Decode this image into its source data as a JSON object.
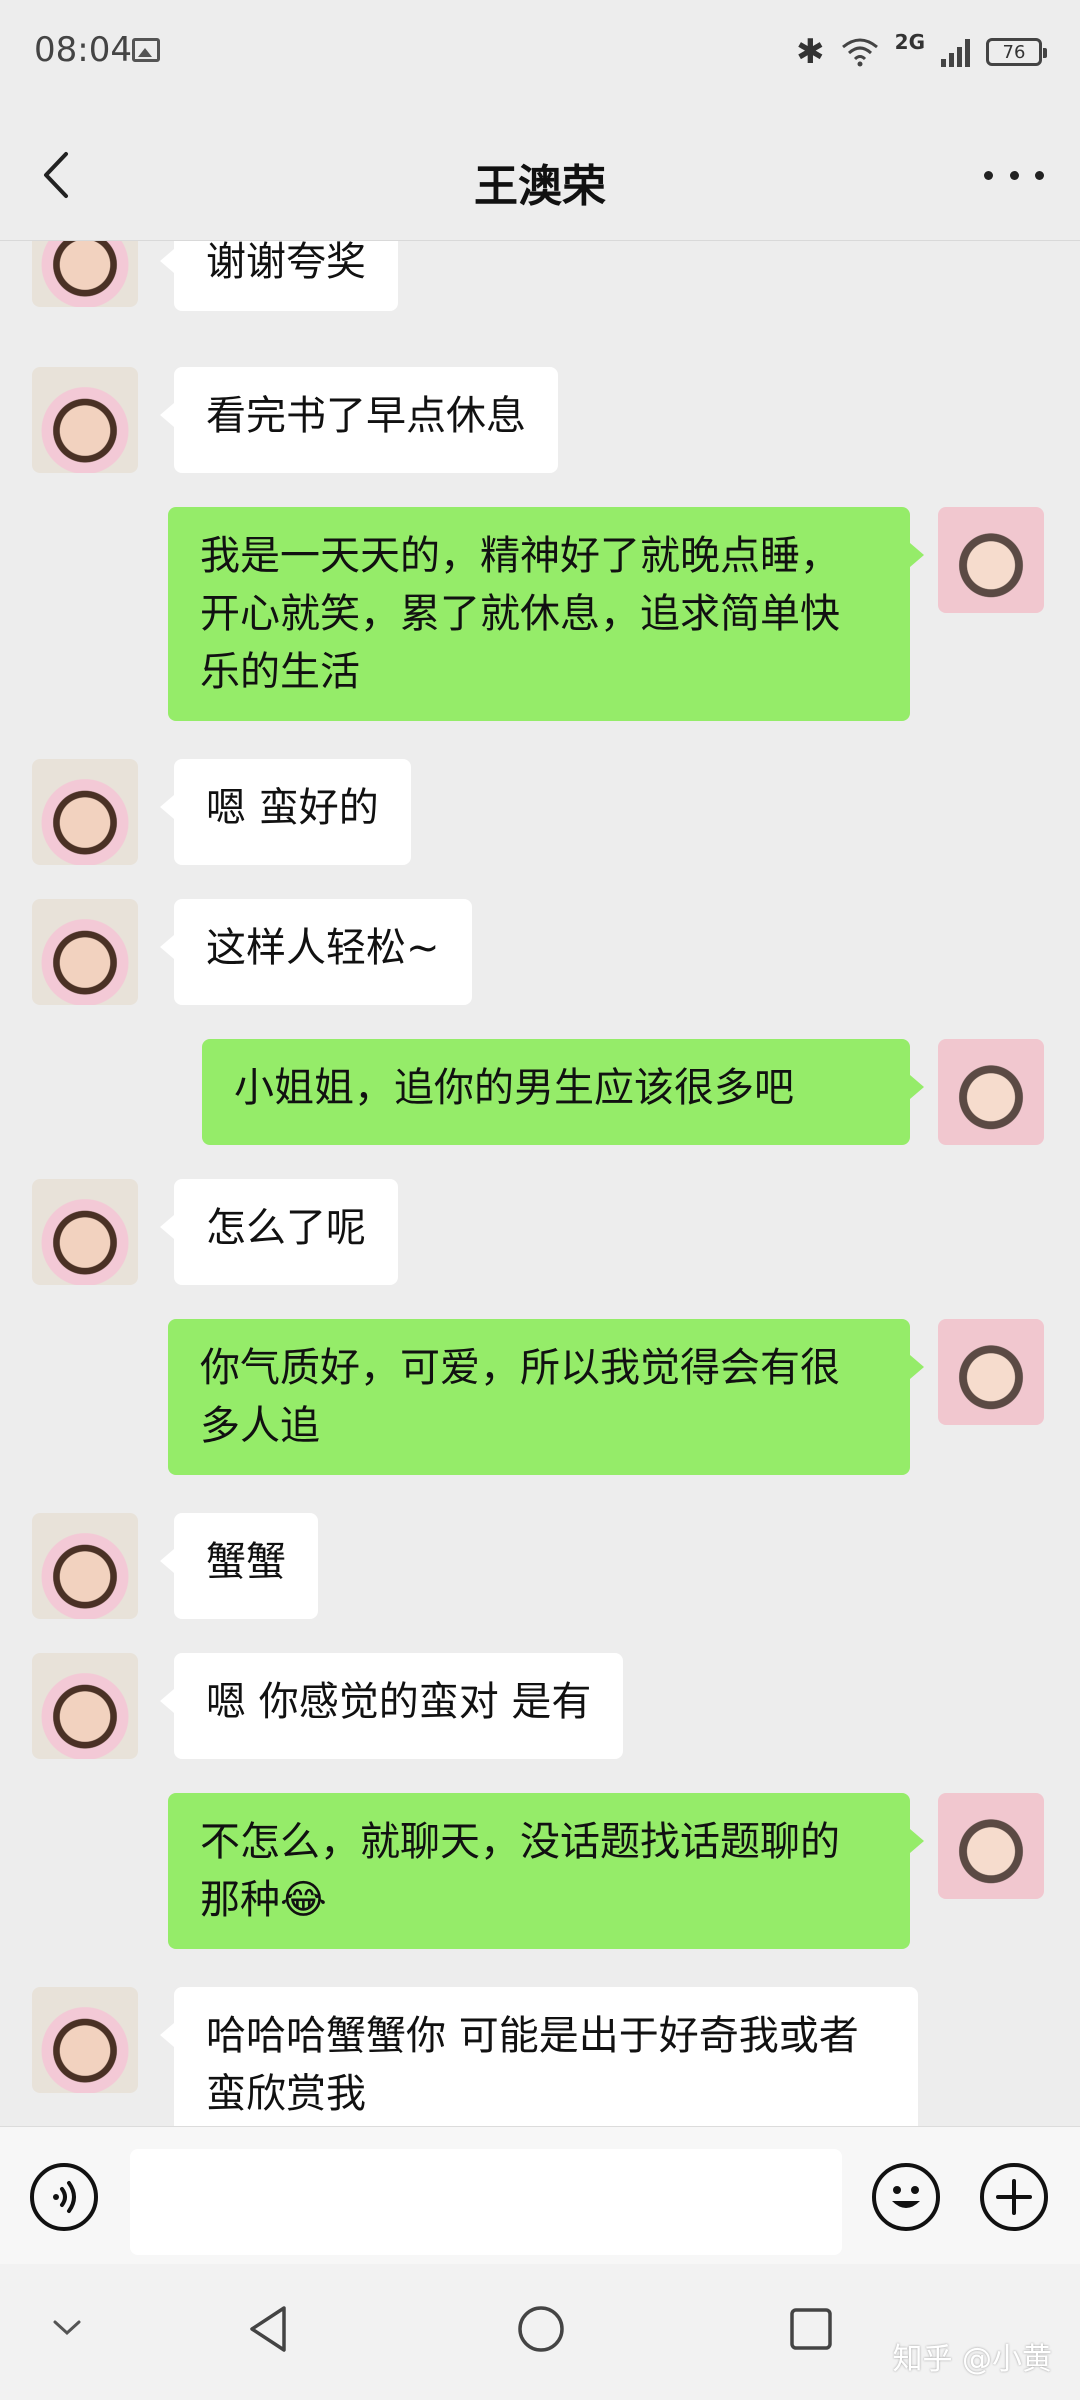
{
  "status_bar": {
    "time": "08:04",
    "network": "2G",
    "battery": "76"
  },
  "header": {
    "title": "王澳荣"
  },
  "messages": [
    {
      "side": "left",
      "text": "谢谢夸奖"
    },
    {
      "side": "left",
      "text": "看完书了早点休息"
    },
    {
      "side": "right",
      "text": "我是一天天的，精神好了就晚点睡，开心就笑，累了就休息，追求简单快乐的生活"
    },
    {
      "side": "left",
      "text": "嗯 蛮好的"
    },
    {
      "side": "left",
      "text": "这样人轻松~"
    },
    {
      "side": "right",
      "text": "小姐姐，追你的男生应该很多吧"
    },
    {
      "side": "left",
      "text": "怎么了呢"
    },
    {
      "side": "right",
      "text": "你气质好，可爱，所以我觉得会有很多人追"
    },
    {
      "side": "left",
      "text": "蟹蟹"
    },
    {
      "side": "left",
      "text": "嗯 你感觉的蛮对  是有"
    },
    {
      "side": "right",
      "text": "不怎么，就聊天，没话题找话题聊的那种😂"
    },
    {
      "side": "left",
      "text": "哈哈哈蟹蟹你  可能是出于好奇我或者蛮欣赏我"
    }
  ],
  "input": {
    "value": ""
  },
  "watermark": "知乎 @小黄",
  "colors": {
    "background": "#ededed",
    "bubble_self": "#95ec69",
    "bubble_other": "#ffffff"
  }
}
